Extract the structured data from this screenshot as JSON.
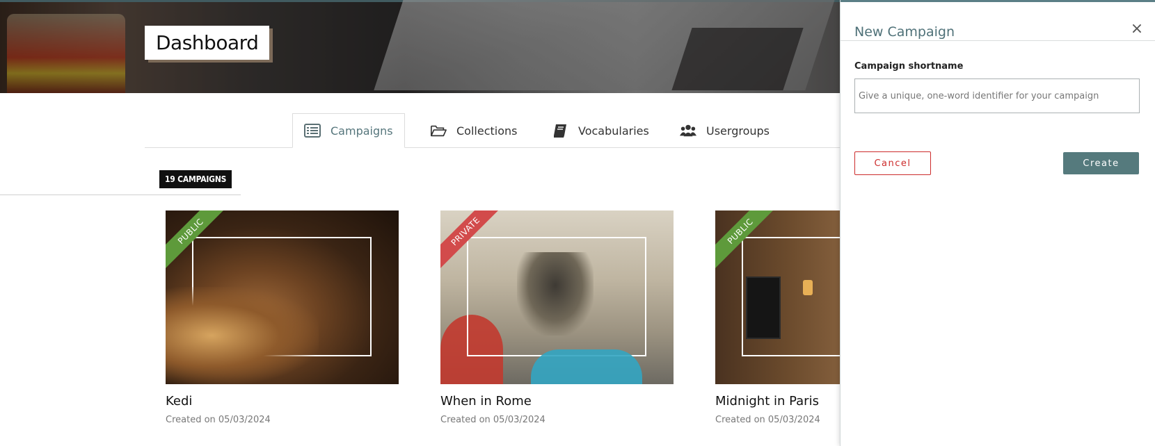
{
  "header": {
    "title": "Dashboard"
  },
  "tabs": [
    {
      "label": "Campaigns",
      "icon": "list-icon",
      "active": true
    },
    {
      "label": "Collections",
      "icon": "folder-open-icon",
      "active": false
    },
    {
      "label": "Vocabularies",
      "icon": "book-icon",
      "active": false
    },
    {
      "label": "Usergroups",
      "icon": "users-icon",
      "active": false
    }
  ],
  "campaign_count": "19 CAMPAIGNS",
  "campaigns": [
    {
      "title": "Kedi",
      "date": "Created on 05/03/2024",
      "visibility": "PUBLIC"
    },
    {
      "title": "When in Rome",
      "date": "Created on 05/03/2024",
      "visibility": "PRIVATE"
    },
    {
      "title": "Midnight in Paris",
      "date": "Created on 05/03/2024",
      "visibility": "PUBLIC"
    }
  ],
  "panel": {
    "title": "New Campaign",
    "close_glyph": "×",
    "field_label": "Campaign shortname",
    "field_placeholder": "Give a unique, one-word identifier for your campaign",
    "field_value": "",
    "cancel_label": "Cancel",
    "create_label": "Create"
  },
  "colors": {
    "accent": "#557a7d",
    "public": "#5e9a3b",
    "private": "#d24b4b",
    "cancel": "#cc2b2b"
  }
}
